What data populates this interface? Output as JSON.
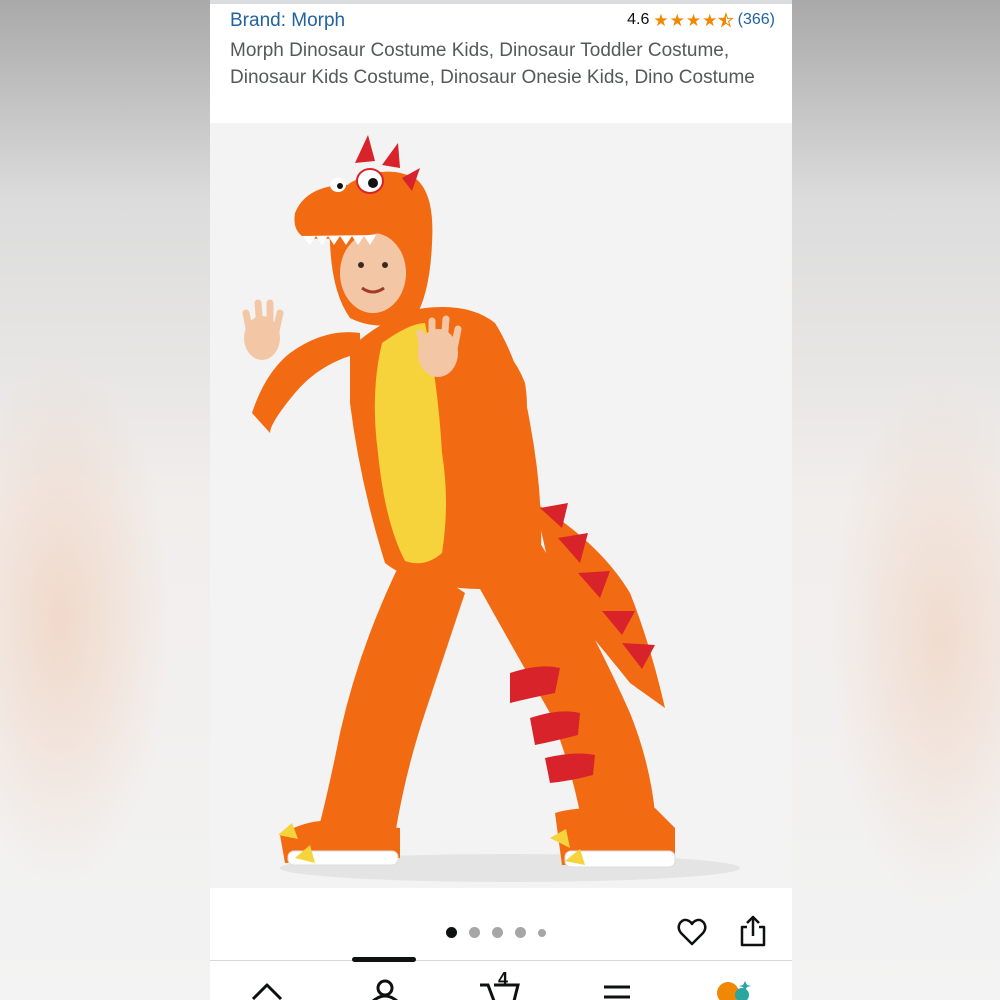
{
  "header": {
    "brand_label": "Brand: Morph",
    "rating_value": "4.6",
    "rating_stars": 4.5,
    "review_count": "(366)",
    "title": "Morph Dinosaur Costume Kids, Dinosaur Toddler Costume, Dinosaur Kids Costume, Dinosaur Onesie Kids, Dino Costume"
  },
  "gallery": {
    "image_subject": "child-in-orange-dinosaur-costume",
    "dot_count": 5,
    "active_index": 0
  },
  "actions": {
    "wishlist_icon": "heart-icon",
    "share_icon": "share-icon"
  },
  "bottom_nav": {
    "items": [
      "home-icon",
      "account-icon",
      "cart-icon",
      "menu-icon",
      "rufus-icon"
    ],
    "cart_count": "4"
  },
  "colors": {
    "brand_link": "#2162a1",
    "star": "#f08804",
    "costume_orange": "#f26b12",
    "costume_belly": "#f6d33a",
    "costume_spikes": "#d8232a"
  }
}
